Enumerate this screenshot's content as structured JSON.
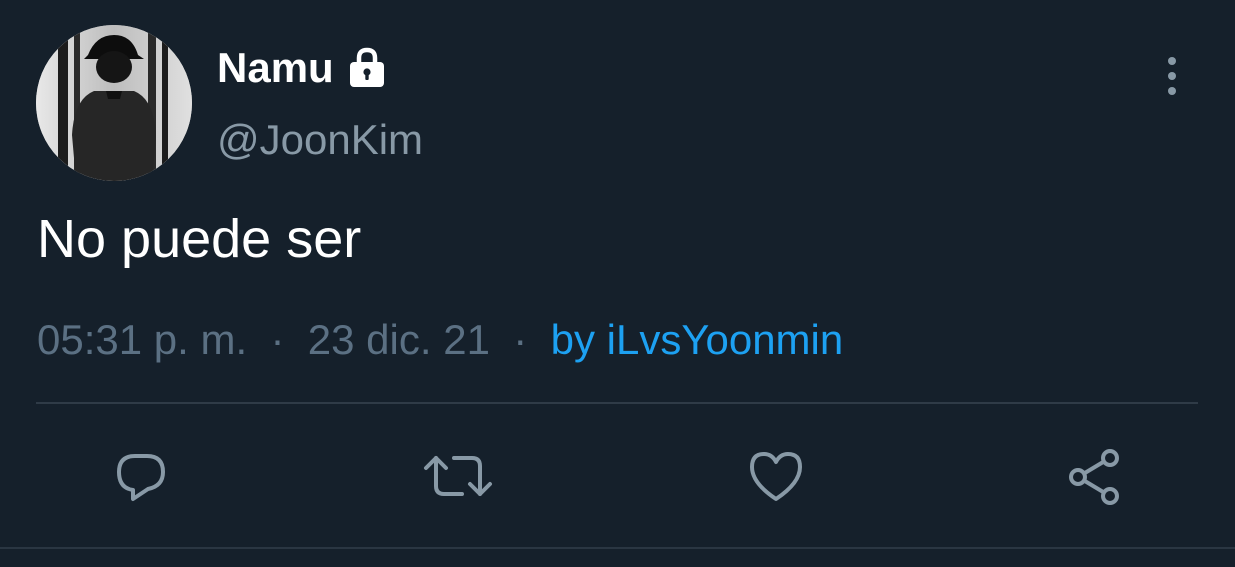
{
  "tweet": {
    "display_name": "Namu",
    "handle": "@JoonKim",
    "text": "No puede ser",
    "time": "05:31 p. m.",
    "date": "23 dic. 21",
    "separator": "·",
    "source": "by iLvsYoonmin",
    "protected": true
  },
  "icons": {
    "lock": "lock-icon",
    "more": "more-vertical-icon",
    "reply": "reply-icon",
    "retweet": "retweet-icon",
    "like": "heart-icon",
    "share": "share-icon"
  },
  "colors": {
    "background": "#15202b",
    "primary_text": "#ffffff",
    "secondary_text": "#8899a6",
    "accent": "#1da1f2",
    "divider": "#2f3b47"
  }
}
